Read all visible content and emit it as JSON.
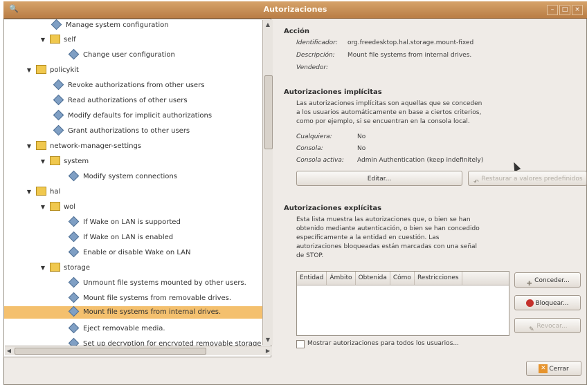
{
  "window": {
    "title": "Autorizaciones"
  },
  "tree": [
    {
      "label": "Manage system configuration",
      "type": "action"
    },
    {
      "label": "self",
      "type": "folder"
    },
    {
      "label": "Change user configuration",
      "type": "action"
    },
    {
      "label": "policykit",
      "type": "folder"
    },
    {
      "label": "Revoke authorizations from other users",
      "type": "action"
    },
    {
      "label": "Read authorizations of other users",
      "type": "action"
    },
    {
      "label": "Modify defaults for implicit authorizations",
      "type": "action"
    },
    {
      "label": "Grant authorizations to other users",
      "type": "action"
    },
    {
      "label": "network-manager-settings",
      "type": "folder"
    },
    {
      "label": "system",
      "type": "folder"
    },
    {
      "label": "Modify system connections",
      "type": "action"
    },
    {
      "label": "hal",
      "type": "folder"
    },
    {
      "label": "wol",
      "type": "folder"
    },
    {
      "label": "If Wake on LAN is supported",
      "type": "action"
    },
    {
      "label": "If Wake on LAN is enabled",
      "type": "action"
    },
    {
      "label": "Enable or disable Wake on LAN",
      "type": "action"
    },
    {
      "label": "storage",
      "type": "folder"
    },
    {
      "label": "Unmount file systems mounted by other users.",
      "type": "action"
    },
    {
      "label": "Mount file systems from removable drives.",
      "type": "action"
    },
    {
      "label": "Mount file systems from internal drives.",
      "type": "action",
      "selected": true
    },
    {
      "label": "Eject removable media.",
      "type": "action"
    },
    {
      "label": "Set up decryption for encrypted removable storage",
      "type": "action"
    }
  ],
  "action": {
    "heading": "Acción",
    "identifier_label": "Identificador:",
    "identifier_value": "org.freedesktop.hal.storage.mount-fixed",
    "description_label": "Descripción:",
    "description_value": "Mount file systems from internal drives.",
    "vendor_label": "Vendedor:"
  },
  "implicit": {
    "heading": "Autorizaciones implícitas",
    "desc1": "Las autorizaciones implícitas son aquellas que se conceden",
    "desc2": "a los usuarios automáticamente en base a ciertos criterios,",
    "desc3": "como por ejemplo, si se encuentran en la consola local.",
    "any_label": "Cualquiera:",
    "any_value": "No",
    "console_label": "Consola:",
    "console_value": "No",
    "active_label": "Consola activa:",
    "active_value": "Admin Authentication (keep indefinitely)",
    "edit_button": "Editar...",
    "restore_button": "Restaurar a valores predefinidos"
  },
  "explicit": {
    "heading": "Autorizaciones explícitas",
    "desc1": "Esta lista muestra las autorizaciones que, o bien se han",
    "desc2": "obtenido mediante autenticación, o bien se han concedido",
    "desc3": "específicamente a la entidad en cuestión. Las",
    "desc4": "autorizaciones bloqueadas están marcadas con una señal",
    "desc5": "de STOP.",
    "columns": [
      "Entidad",
      "Ámbito",
      "Obtenida",
      "Cómo",
      "Restricciones"
    ],
    "grant_button": "Conceder...",
    "block_button": "Bloquear...",
    "revoke_button": "Revocar...",
    "show_all_label": "Mostrar autorizaciones para todos los usuarios..."
  },
  "footer": {
    "close_button": "Cerrar"
  }
}
